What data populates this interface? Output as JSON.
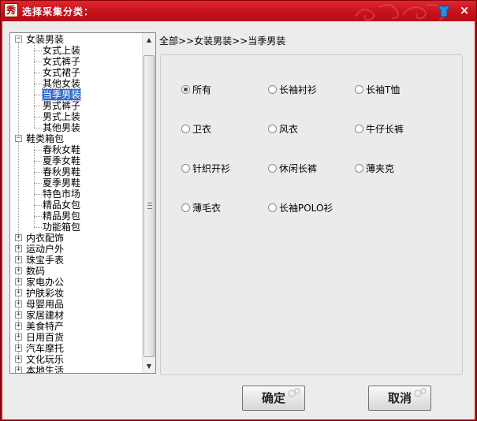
{
  "window": {
    "title": "选择采集分类：",
    "app_icon_glyph": "秀",
    "accent_color": "#c8101a",
    "close_glyph": "×"
  },
  "breadcrumb": "全部>>女装男装>>当季男装",
  "tree": {
    "nodes": [
      {
        "label": "女装男装",
        "level": 0,
        "expanded": true
      },
      {
        "label": "女式上装",
        "level": 1
      },
      {
        "label": "女式裤子",
        "level": 1
      },
      {
        "label": "女式裙子",
        "level": 1
      },
      {
        "label": "其他女装",
        "level": 1
      },
      {
        "label": "当季男装",
        "level": 1,
        "selected": true
      },
      {
        "label": "男式裤子",
        "level": 1
      },
      {
        "label": "男式上装",
        "level": 1
      },
      {
        "label": "其他男装",
        "level": 1
      },
      {
        "label": "鞋类箱包",
        "level": 0,
        "expanded": true
      },
      {
        "label": "春秋女鞋",
        "level": 1
      },
      {
        "label": "夏季女鞋",
        "level": 1
      },
      {
        "label": "春秋男鞋",
        "level": 1
      },
      {
        "label": "夏季男鞋",
        "level": 1
      },
      {
        "label": "特色市场",
        "level": 1
      },
      {
        "label": "精品女包",
        "level": 1
      },
      {
        "label": "精品男包",
        "level": 1
      },
      {
        "label": "功能箱包",
        "level": 1
      },
      {
        "label": "内衣配饰",
        "level": 0,
        "expanded": false
      },
      {
        "label": "运动户外",
        "level": 0,
        "expanded": false
      },
      {
        "label": "珠宝手表",
        "level": 0,
        "expanded": false
      },
      {
        "label": "数码",
        "level": 0,
        "expanded": false
      },
      {
        "label": "家电办公",
        "level": 0,
        "expanded": false
      },
      {
        "label": "护肤彩妆",
        "level": 0,
        "expanded": false
      },
      {
        "label": "母婴用品",
        "level": 0,
        "expanded": false
      },
      {
        "label": "家居建材",
        "level": 0,
        "expanded": false
      },
      {
        "label": "美食特产",
        "level": 0,
        "expanded": false
      },
      {
        "label": "日用百货",
        "level": 0,
        "expanded": false
      },
      {
        "label": "汽车摩托",
        "level": 0,
        "expanded": false
      },
      {
        "label": "文化玩乐",
        "level": 0,
        "expanded": false
      },
      {
        "label": "本地生活",
        "level": 0,
        "expanded": false
      }
    ],
    "toggle_expanded": "−",
    "toggle_collapsed": "+"
  },
  "scrollbar": {
    "up": "▲",
    "down": "▼"
  },
  "options": [
    {
      "label": "所有",
      "checked": true
    },
    {
      "label": "长袖衬衫",
      "checked": false
    },
    {
      "label": "长袖T恤",
      "checked": false
    },
    {
      "label": "卫衣",
      "checked": false
    },
    {
      "label": "风衣",
      "checked": false
    },
    {
      "label": "牛仔长裤",
      "checked": false
    },
    {
      "label": "针织开衫",
      "checked": false
    },
    {
      "label": "休闲长裤",
      "checked": false
    },
    {
      "label": "薄夹克",
      "checked": false
    },
    {
      "label": "薄毛衣",
      "checked": false
    },
    {
      "label": "长袖POLO衫",
      "checked": false
    }
  ],
  "buttons": {
    "ok": "确定",
    "cancel": "取消"
  }
}
